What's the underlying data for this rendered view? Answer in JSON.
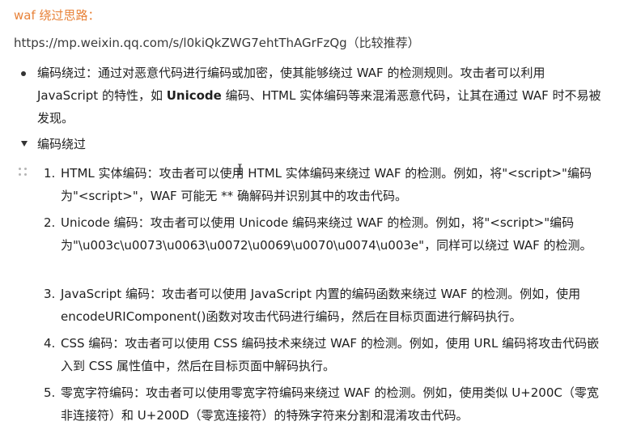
{
  "heading": "waf 绕过思路：",
  "url_line": "https://mp.weixin.qq.com/s/l0kiQkZWG7ehtThAGrFzQg（比较推荐）",
  "bullet": {
    "prefix": "编码绕过：通过对恶意代码进行编码或加密，使其能够绕过 WAF 的检测规则。攻击者可以利用 JavaScript 的特性，如 ",
    "bold": "Unicode",
    "suffix": " 编码、HTML 实体编码等来混淆恶意代码，让其在通过 WAF 时不易被发现。"
  },
  "toggle_label": "编码绕过",
  "items": [
    {
      "num": "1.",
      "text": "HTML 实体编码：攻击者可以使用 HTML 实体编码来绕过 WAF 的检测。例如，将\"<script>\"编码为\"<script>\"，WAF 可能无 ** 确解码并识别其中的攻击代码。"
    },
    {
      "num": "2.",
      "text": "Unicode 编码：攻击者可以使用 Unicode 编码来绕过 WAF 的检测。例如，将\"<script>\"编码为\"\\u003c\\u0073\\u0063\\u0072\\u0069\\u0070\\u0074\\u003e\"，同样可以绕过 WAF 的检测。"
    },
    {
      "num": "3.",
      "text": "JavaScript 编码：攻击者可以使用 JavaScript 内置的编码函数来绕过 WAF 的检测。例如，使用 encodeURIComponent()函数对攻击代码进行编码，然后在目标页面进行解码执行。"
    },
    {
      "num": "4.",
      "text": "CSS 编码：攻击者可以使用 CSS 编码技术来绕过 WAF 的检测。例如，使用 URL 编码将攻击代码嵌入到 CSS 属性值中，然后在目标页面中解码执行。"
    },
    {
      "num": "5.",
      "text": "零宽字符编码：攻击者可以使用零宽字符编码来绕过 WAF 的检测。例如，使用类似 U+200C（零宽非连接符）和 U+200D（零宽连接符）的特殊字符来分割和混淆攻击代码。"
    }
  ]
}
